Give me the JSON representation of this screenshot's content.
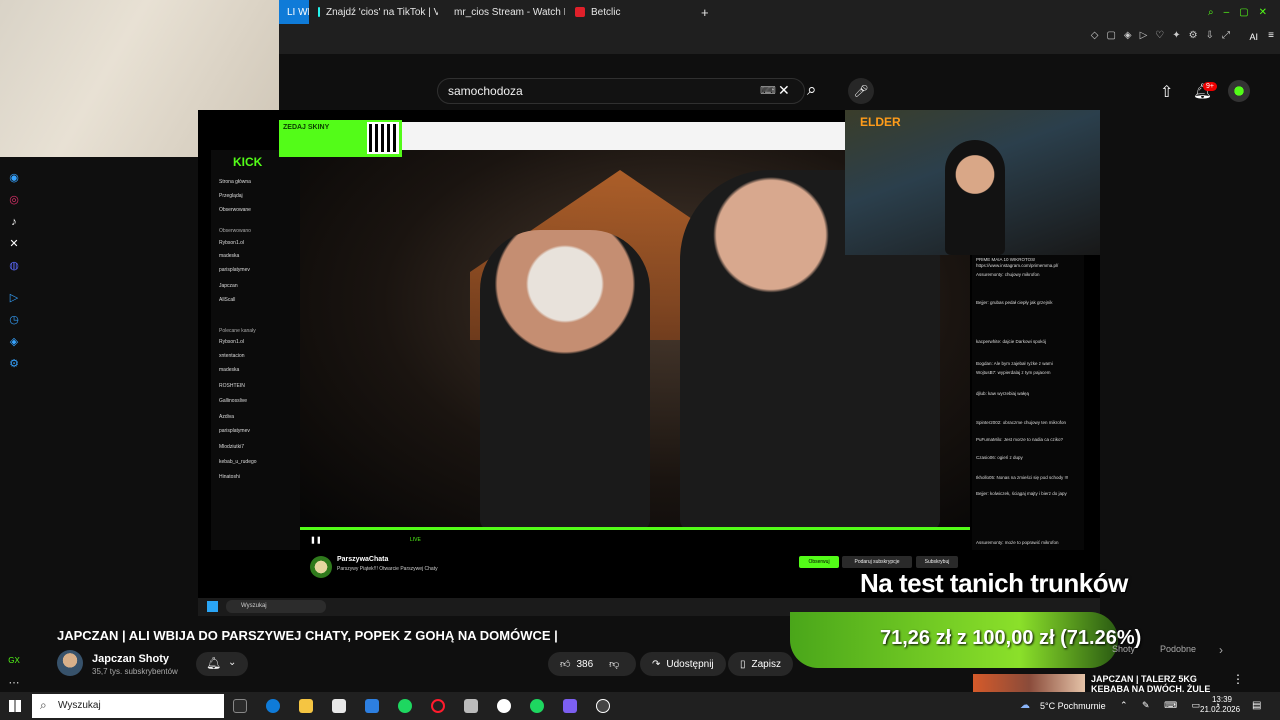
{
  "browser": {
    "tabs": [
      {
        "label": "LI WB",
        "active": true
      },
      {
        "label": "Znajdź 'cios' na TikTok | V"
      },
      {
        "label": "mr_cios Stream - Watch L"
      },
      {
        "label": "Betclic"
      }
    ],
    "new_tab_symbol": "+",
    "profile_label": "AI"
  },
  "youtube": {
    "search_value": "samochodoza",
    "notifications_badge": "9+",
    "video_title": "JAPCZAN | ALI WBIJA DO PARSZYWEJ CHATY, POPEK Z GOHĄ NA DOMÓWCE |",
    "channel_name": "Japczan Shoty",
    "subscribers": "35,7 tys. subskrybentów",
    "likes": "386",
    "share_label": "Udostępnij",
    "save_label": "Zapisz",
    "shorts_label": "Shoty",
    "similar_label": "Podobne",
    "recommended_title": "JAPCZAN | TALERZ 5KG KEBABA NA DWÓCH, ŻULE"
  },
  "stream": {
    "caption": "Na test tanich trunków",
    "goal_text": "71,26 zł z 100,00 zł (71.26%)",
    "goal_fraction": 0.7126,
    "elder_tag": "ELDER",
    "kick_logo": "KICK",
    "qr_text": "ZEDAJ SKINY",
    "streamer_name": "ParszywaChata",
    "streamer_title": "Parszywy Piątek!!! Otwarcie Parszywej Chaty",
    "follow_label": "Obserwuj",
    "gift_label": "Podaruj subskrypcje",
    "sub_label": "Subskrybuj",
    "inner_search": "Wyszukaj",
    "live_label": "LIVE",
    "sidebar": {
      "home": "Strona główna",
      "browse": "Przeglądaj",
      "following": "Obserwowane",
      "followed_header": "Obserwowano",
      "followed": [
        "Rybson1.ol",
        "madeska",
        "parisplatymev",
        "Japczan",
        "AllScall"
      ],
      "recommended_header": "Polecane kanały",
      "recommended": [
        "Rybson1.ol",
        "xntentacion",
        "madeska",
        "ROSHTEIN",
        "Gallinosslive",
        "Azdiva",
        "parisplatymev",
        "Mlodziutki7",
        "kebab_u_rudego",
        "Hinatoshi"
      ]
    },
    "chat_lines": [
      "PRIME MAIA 10 WIKROTOS!",
      "https://www.instagram.com/primemma.pl/",
      "Assuremonty: chujowy mikrofon",
      "Bejjer: grubas pedał ciepły jak grzejnik",
      "kacperwhite: dajcie Darkowi spokój",
      "Bogdan: Ale bym zajebał ryżke z wami",
      "WojtusB7: wypierdalaj z tym pajacem",
      "djlub: kaw wyrzebiaj wałęą",
      "Spinter2002: obraczme chujowy ten mikrofon",
      "PuFumaMilo: Jest morze to nadia ca cziko?",
      "Czasio06: ogień z dupy",
      "Ikhollo05: Nonas na zmieści się pod schody !!!",
      "Bejjer: kolwiczek, ściągaj majty i bierz do japy",
      "Assuremonty: może to poprawić mikrofon"
    ]
  },
  "windows": {
    "search_placeholder": "Wyszukaj",
    "weather": "5°C  Pochmurnie",
    "time": "13:39",
    "date": "21.02.2026"
  }
}
